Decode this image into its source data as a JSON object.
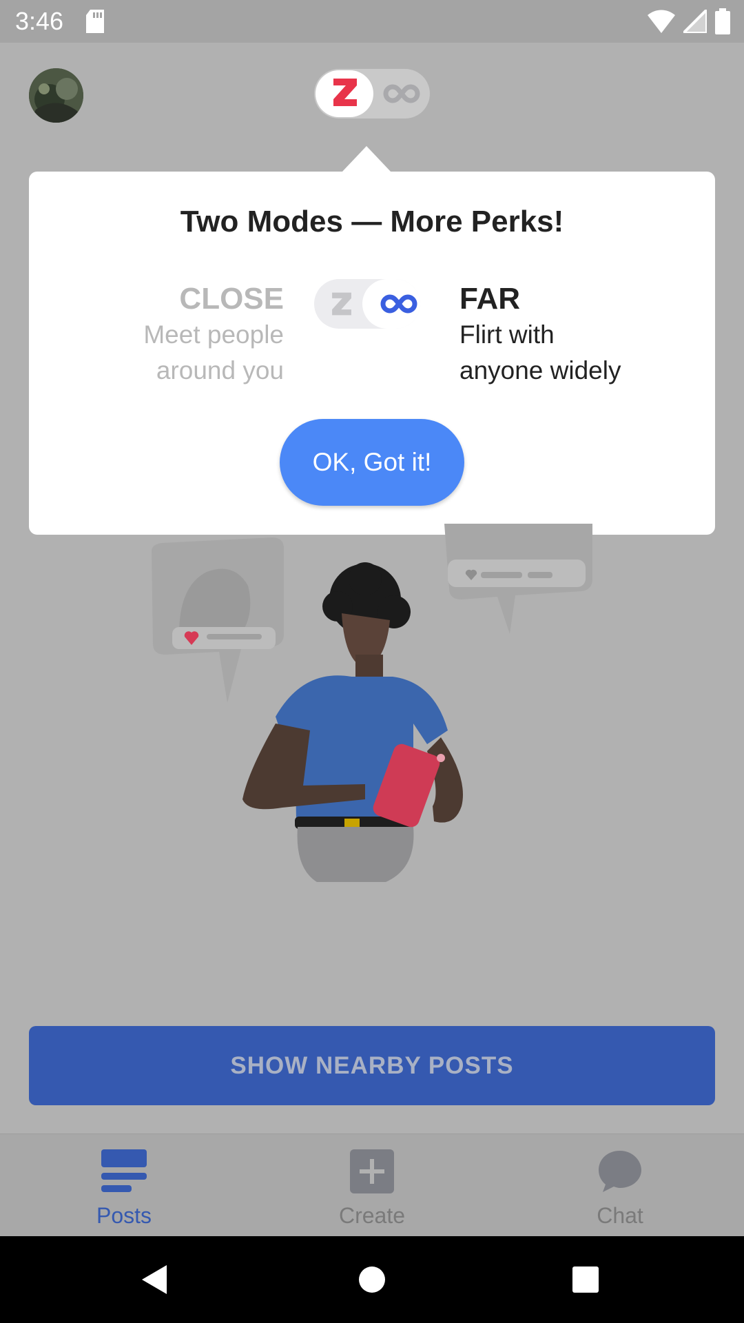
{
  "status_bar": {
    "time": "3:46"
  },
  "tooltip": {
    "title": "Two Modes — More Perks!",
    "close_mode": {
      "heading": "CLOSE",
      "desc_line1": "Meet people",
      "desc_line2": "around you"
    },
    "far_mode": {
      "heading": "FAR",
      "desc_line1": "Flirt with",
      "desc_line2": "anyone widely"
    },
    "ok_label": "OK, Got it!"
  },
  "main": {
    "show_nearby_label": "SHOW NEARBY POSTS"
  },
  "bottom_nav": {
    "items": [
      {
        "label": "Posts",
        "icon": "posts-icon",
        "active": true
      },
      {
        "label": "Create",
        "icon": "create-icon",
        "active": false
      },
      {
        "label": "Chat",
        "icon": "chat-icon",
        "active": false
      }
    ]
  },
  "colors": {
    "accent": "#4b88f7",
    "brand_red": "#e8344a",
    "nav_active": "#3559b0",
    "overlay": "#b1b1b1"
  }
}
